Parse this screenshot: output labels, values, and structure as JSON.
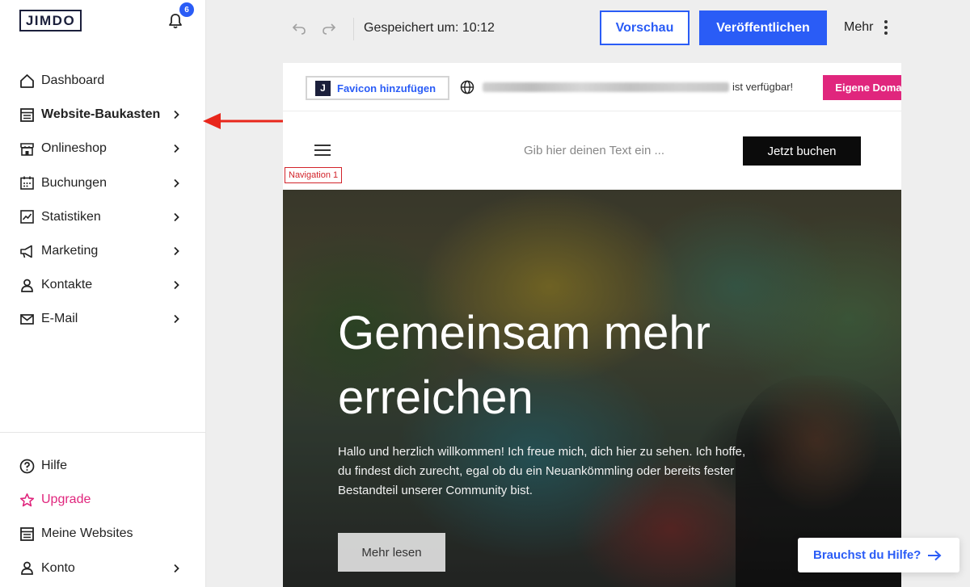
{
  "sidebar": {
    "logo": "JIMDO",
    "notification_count": "6",
    "items": [
      {
        "label": "Dashboard",
        "icon": "home-icon",
        "chevron": false
      },
      {
        "label": "Website-Baukasten",
        "icon": "builder-icon",
        "chevron": true,
        "active": true
      },
      {
        "label": "Onlineshop",
        "icon": "shop-icon",
        "chevron": true
      },
      {
        "label": "Buchungen",
        "icon": "calendar-icon",
        "chevron": true
      },
      {
        "label": "Statistiken",
        "icon": "stats-icon",
        "chevron": true
      },
      {
        "label": "Marketing",
        "icon": "megaphone-icon",
        "chevron": true
      },
      {
        "label": "Kontakte",
        "icon": "person-icon",
        "chevron": true
      },
      {
        "label": "E-Mail",
        "icon": "mail-icon",
        "chevron": true
      }
    ],
    "bottom_items": [
      {
        "label": "Hilfe",
        "icon": "help-circle-icon"
      },
      {
        "label": "Upgrade",
        "icon": "star-icon"
      },
      {
        "label": "Meine Websites",
        "icon": "websites-icon"
      },
      {
        "label": "Konto",
        "icon": "person-icon"
      }
    ]
  },
  "toolbar": {
    "saved_status": "Gespeichert um: 10:12",
    "preview_label": "Vorschau",
    "publish_label": "Veröffentlichen",
    "more_label": "Mehr"
  },
  "domain_bar": {
    "favicon_label": "Favicon hinzufügen",
    "availability_text": "ist verfügbar!",
    "domain_button_label": "Eigene Domain nutzen"
  },
  "site_nav": {
    "placeholder_text": "Gib hier deinen Text ein ...",
    "book_button_label": "Jetzt buchen",
    "nav_tag": "Navigation 1"
  },
  "hero": {
    "title": "Gemeinsam mehr erreichen",
    "text": "Hallo und herzlich willkommen! Ich freue mich, dich hier zu sehen. Ich hoffe, du findest dich zurecht, egal ob du ein Neuankömmling oder bereits fester Bestandteil unserer Community bist.",
    "button_label": "Mehr lesen"
  },
  "help_button_label": "Brauchst du Hilfe?",
  "colors": {
    "accent_blue": "#2a5cf6",
    "brand_pink": "#e0267d",
    "annotation_red": "#e8261b"
  }
}
